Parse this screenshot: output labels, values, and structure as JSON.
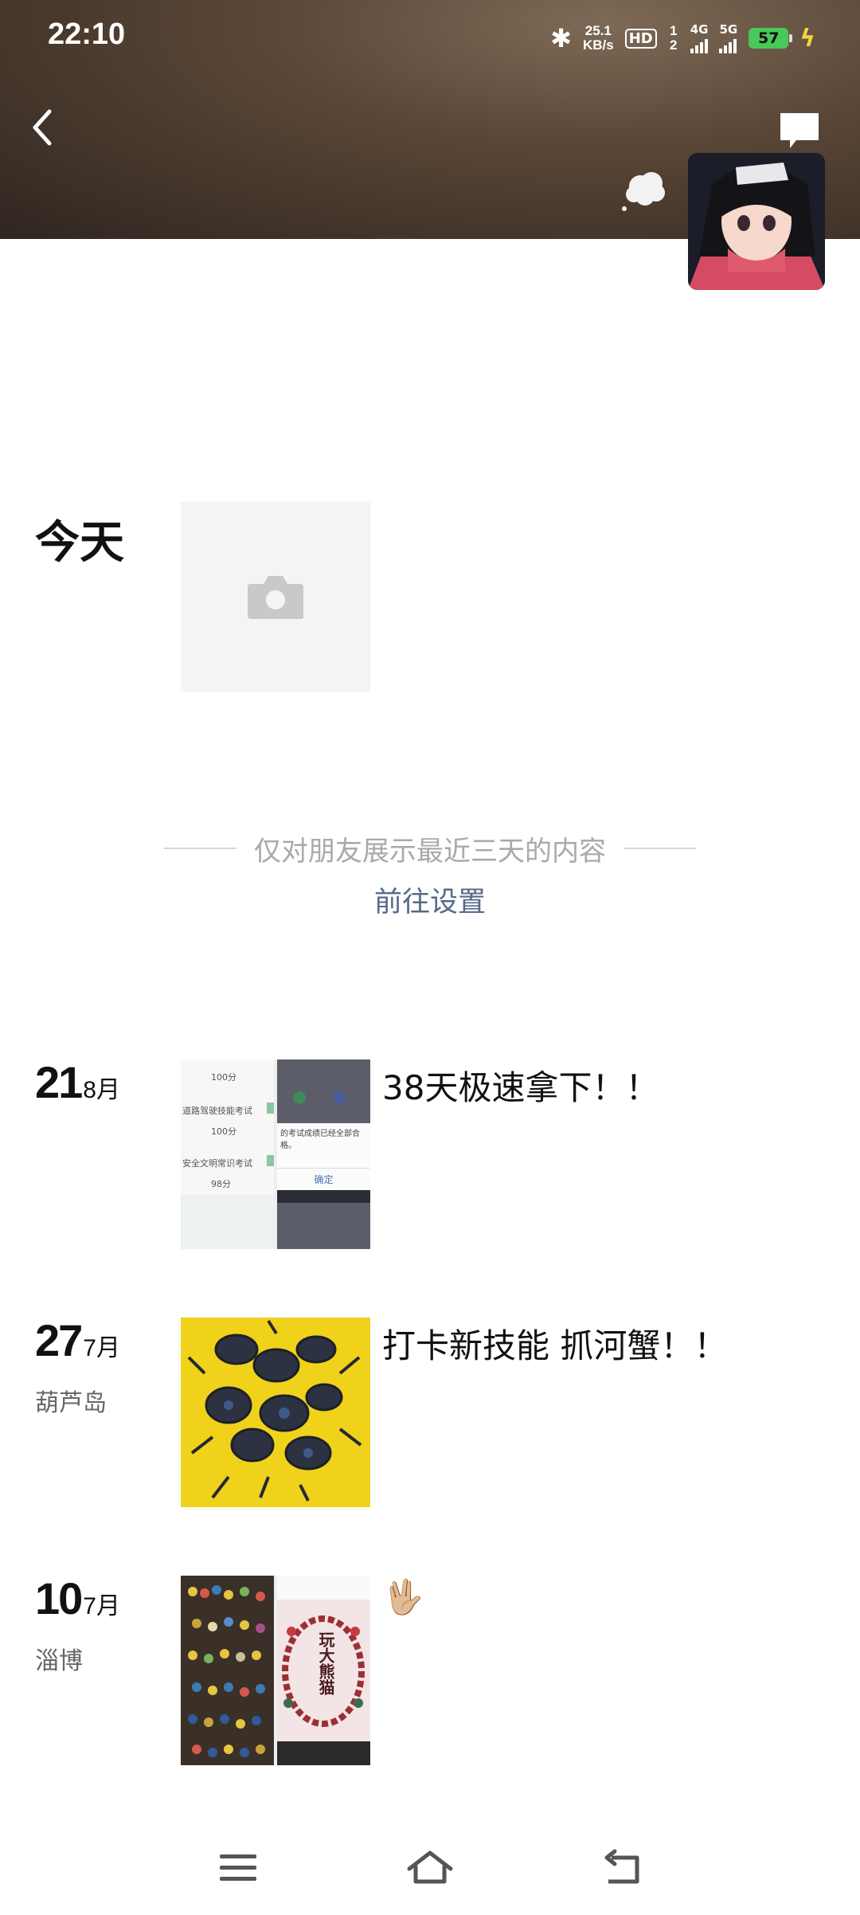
{
  "status_bar": {
    "time": "22:10",
    "speed_top": "25.1",
    "speed_bottom": "KB/s",
    "hd_label": "HD",
    "sim_numbers": "1 2",
    "net1": "4G",
    "net2": "5G",
    "battery": "57"
  },
  "header": {
    "back_icon": "chevron-left-icon",
    "message_icon": "comment-icon",
    "status_icon": "thought-bubble-icon"
  },
  "today": {
    "label": "今天",
    "upload_icon": "camera-icon"
  },
  "privacy": {
    "notice": "仅对朋友展示最近三天的内容",
    "link": "前往设置"
  },
  "posts": [
    {
      "day": "21",
      "month": "8月",
      "location": "",
      "text": "38天极速拿下！！"
    },
    {
      "day": "27",
      "month": "7月",
      "location": "葫芦岛",
      "text": "打卡新技能 抓河蟹！！"
    },
    {
      "day": "10",
      "month": "7月",
      "location": "淄博",
      "text": "🖖🏼"
    }
  ],
  "post1_screens": {
    "left_rows": [
      "100分",
      "道路驾驶技能考试",
      "100分",
      "安全文明常识考试",
      "98分"
    ],
    "right_dialog": "的考试成绩已经全部合格。",
    "right_button": "确定"
  },
  "post3_bracelet_text": "玩大熊猫",
  "nav": {
    "menu_icon": "menu-icon",
    "home_icon": "home-icon",
    "back_icon": "return-icon"
  },
  "colors": {
    "link": "#56698a",
    "battery": "#49c95a",
    "divider": "#d6d6d6"
  }
}
